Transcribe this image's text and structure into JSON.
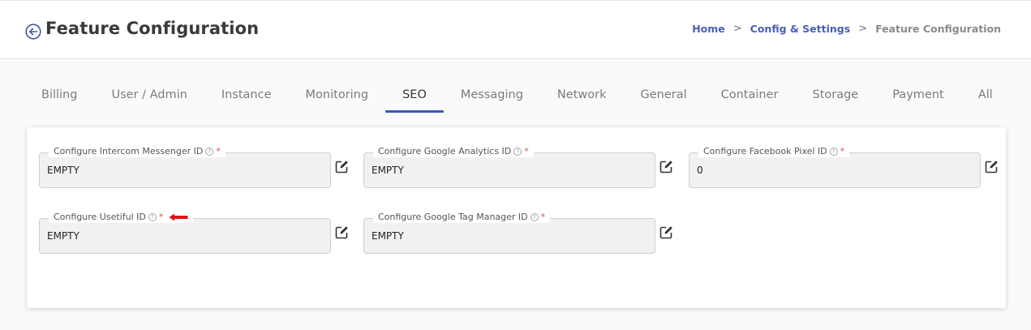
{
  "header": {
    "title": "Feature Configuration",
    "breadcrumb": {
      "home": "Home",
      "config": "Config & Settings",
      "current": "Feature Configuration",
      "separator": ">"
    }
  },
  "tabs": [
    {
      "label": "Billing"
    },
    {
      "label": "User / Admin"
    },
    {
      "label": "Instance"
    },
    {
      "label": "Monitoring"
    },
    {
      "label": "SEO",
      "active": true
    },
    {
      "label": "Messaging"
    },
    {
      "label": "Network"
    },
    {
      "label": "General"
    },
    {
      "label": "Container"
    },
    {
      "label": "Storage"
    },
    {
      "label": "Payment"
    },
    {
      "label": "All"
    }
  ],
  "fields": {
    "intercom": {
      "label": "Configure Intercom Messenger ID",
      "value": "EMPTY",
      "required": "*"
    },
    "analytics": {
      "label": "Configure Google Analytics ID",
      "value": "EMPTY",
      "required": "*"
    },
    "facebook": {
      "label": "Configure Facebook Pixel ID",
      "value": "0",
      "required": "*"
    },
    "usetiful": {
      "label": "Configure Usetiful ID",
      "value": "EMPTY",
      "required": "*"
    },
    "tagmanager": {
      "label": "Configure Google Tag Manager ID",
      "value": "EMPTY",
      "required": "*"
    }
  },
  "icons": {
    "help": "?",
    "accent": "#3e57b1",
    "arrow_color": "#e01010"
  }
}
